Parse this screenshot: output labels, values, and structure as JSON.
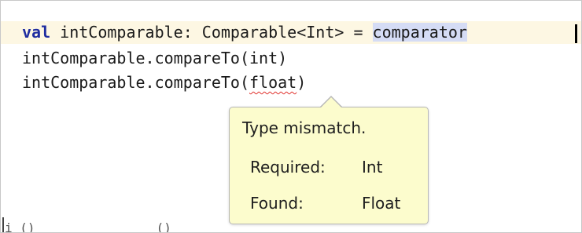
{
  "editor": {
    "line1": {
      "keyword": "val",
      "text": " intComparable: Comparable<Int> = ",
      "selected": "comparator"
    },
    "line2": {
      "text": "intComparable.compareTo(int)"
    },
    "line3": {
      "before": "intComparable.compareTo(",
      "error_word": "float",
      "after": ")"
    },
    "partial_bottom_line": "i ()                ()"
  },
  "tooltip": {
    "title": "Type mismatch.",
    "required_label": "Required:",
    "required_value": "Int",
    "found_label": "Found:",
    "found_value": "Float"
  },
  "colors": {
    "keyword": "#1f2da0",
    "current_line": "#fdf7e3",
    "selection": "#d5dcf5",
    "error_underline": "#e0312c",
    "tooltip_bg": "#fcfccd"
  }
}
